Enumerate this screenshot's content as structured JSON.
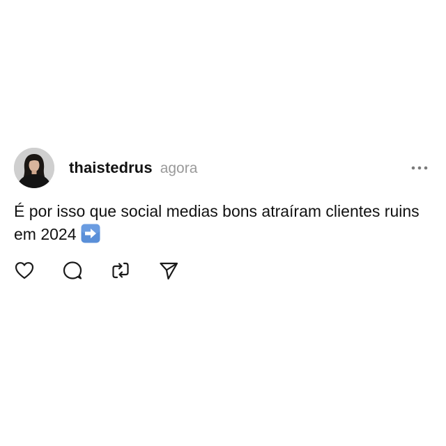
{
  "post": {
    "username": "thaistedrus",
    "timestamp": "agora",
    "text": "É por isso que social medias bons atraíram clientes ruins em 2024",
    "emoji": "arrow-right-emoji"
  },
  "icons": {
    "more": "more-horizontal-icon",
    "like": "heart-icon",
    "reply": "comment-icon",
    "repost": "repost-icon",
    "share": "send-icon"
  },
  "colors": {
    "text": "#111111",
    "muted": "#9a9a9a",
    "icon": "#1a1a1a",
    "emoji_blue": "#5a8fd8"
  }
}
